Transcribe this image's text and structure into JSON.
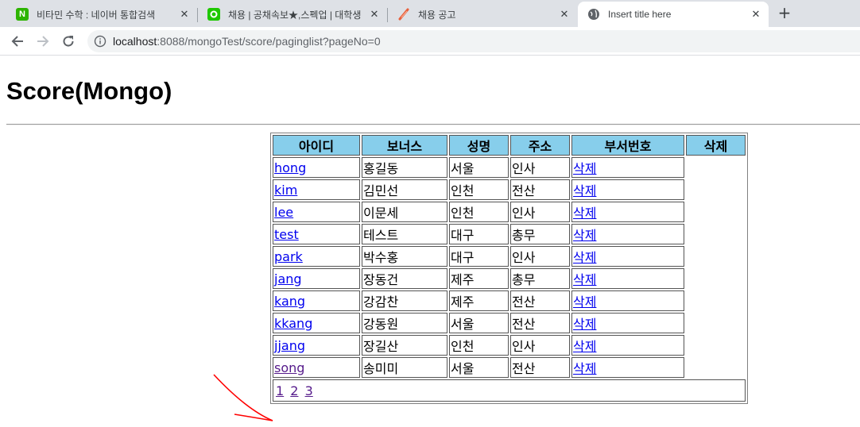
{
  "browser": {
    "tabs": [
      {
        "title": "비타민 수학 : 네이버 통합검색",
        "icon": "naver-n-icon",
        "active": false
      },
      {
        "title": "채용 | 공채속보★,스펙업 | 대학생",
        "icon": "spec-up-icon",
        "active": false
      },
      {
        "title": "채용 공고",
        "icon": "feather-icon",
        "active": false
      },
      {
        "title": "Insert title here",
        "icon": "globe-icon",
        "active": true
      }
    ],
    "url_host": "localhost",
    "url_rest": ":8088/mongoTest/score/paginglist?pageNo=0"
  },
  "page": {
    "title": "Score(Mongo)",
    "headers": [
      "아이디",
      "보너스",
      "성명",
      "주소",
      "부서번호",
      "삭제"
    ],
    "rows": [
      {
        "id": "hong",
        "name": "홍길동",
        "city": "서울",
        "dept": "인사",
        "delete": "삭제"
      },
      {
        "id": "kim",
        "name": "김민선",
        "city": "인천",
        "dept": "전산",
        "delete": "삭제"
      },
      {
        "id": "lee",
        "name": "이문세",
        "city": "인천",
        "dept": "인사",
        "delete": "삭제"
      },
      {
        "id": "test",
        "name": "테스트",
        "city": "대구",
        "dept": "총무",
        "delete": "삭제"
      },
      {
        "id": "park",
        "name": "박수홍",
        "city": "대구",
        "dept": "인사",
        "delete": "삭제"
      },
      {
        "id": "jang",
        "name": "장동건",
        "city": "제주",
        "dept": "총무",
        "delete": "삭제"
      },
      {
        "id": "kang",
        "name": "강감찬",
        "city": "제주",
        "dept": "전산",
        "delete": "삭제"
      },
      {
        "id": "kkang",
        "name": "강동원",
        "city": "서울",
        "dept": "전산",
        "delete": "삭제"
      },
      {
        "id": "jjang",
        "name": "장길산",
        "city": "인천",
        "dept": "인사",
        "delete": "삭제"
      },
      {
        "id": "song",
        "name": "송미미",
        "city": "서울",
        "dept": "전산",
        "delete": "삭제"
      }
    ],
    "pages": [
      "1",
      "2",
      "3"
    ]
  },
  "colors": {
    "header_bg": "#87ceeb",
    "link": "#0000ee",
    "visited_link": "#551a8b",
    "annotation": "#ff0000"
  }
}
